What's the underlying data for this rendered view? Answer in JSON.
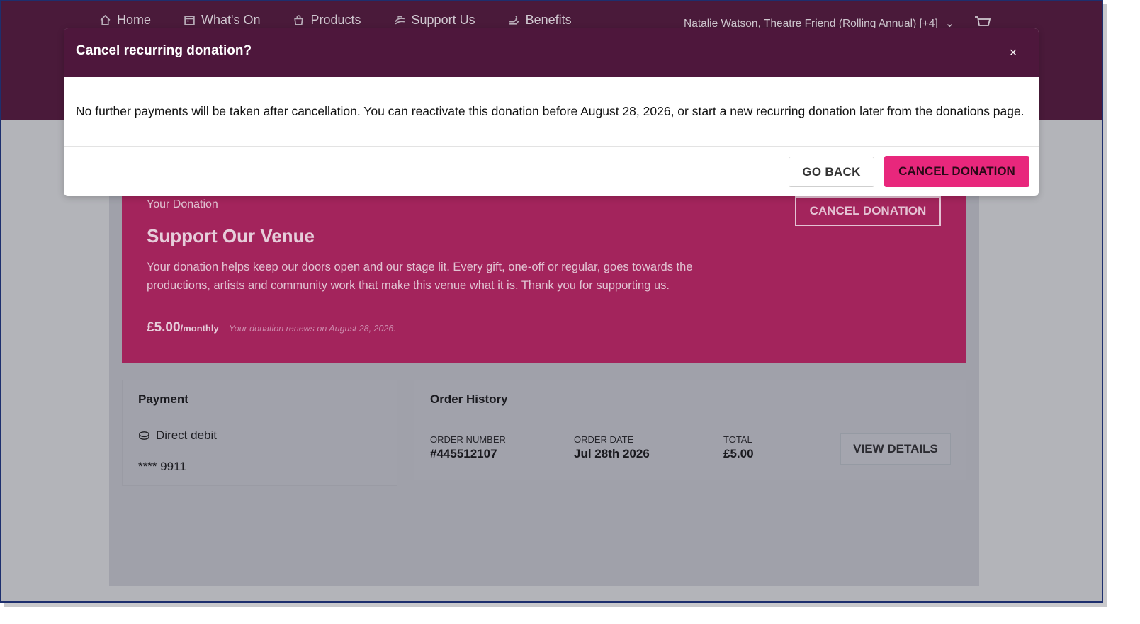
{
  "nav": {
    "items": [
      {
        "label": "Home",
        "icon": "home-icon"
      },
      {
        "label": "What's On",
        "icon": "calendar-icon"
      },
      {
        "label": "Products",
        "icon": "bag-icon"
      },
      {
        "label": "Support Us",
        "icon": "hands-icon"
      },
      {
        "label": "Benefits",
        "icon": "gift-icon"
      }
    ],
    "user_label": "Natalie Watson, Theatre Friend (Rolling Annual) [+4]",
    "user_chevron": "⌄"
  },
  "donation": {
    "label": "Your Donation",
    "title": "Support Our Venue",
    "description": "Your donation helps keep our doors open and our stage lit. Every gift, one-off or regular, goes towards the productions, artists and community work that make this venue what it is. Thank you for supporting us.",
    "amount": "£5.00",
    "frequency": "/monthly",
    "renewal_note": "Your donation renews on August 28, 2026.",
    "cancel_label": "CANCEL DONATION"
  },
  "payment": {
    "heading": "Payment",
    "method": "Direct debit",
    "card": "**** 9911"
  },
  "order_history": {
    "heading": "Order History",
    "columns": [
      {
        "key": "ORDER NUMBER",
        "value": "#445512107"
      },
      {
        "key": "ORDER DATE",
        "value": "Jul 28th 2026"
      },
      {
        "key": "TOTAL",
        "value": "£5.00"
      }
    ],
    "view_label": "VIEW DETAILS"
  },
  "modal": {
    "title": "Cancel recurring donation?",
    "close": "×",
    "body": "No further payments will be taken after cancellation. You can reactivate this donation before August 28, 2026, or start a new recurring donation later from the donations page.",
    "back_label": "GO BACK",
    "confirm_label": "CANCEL DONATION"
  },
  "colors": {
    "header": "#4a1a3a",
    "modal_header": "#4e173c",
    "donation_card": "#a3245c",
    "accent": "#e8277c"
  }
}
